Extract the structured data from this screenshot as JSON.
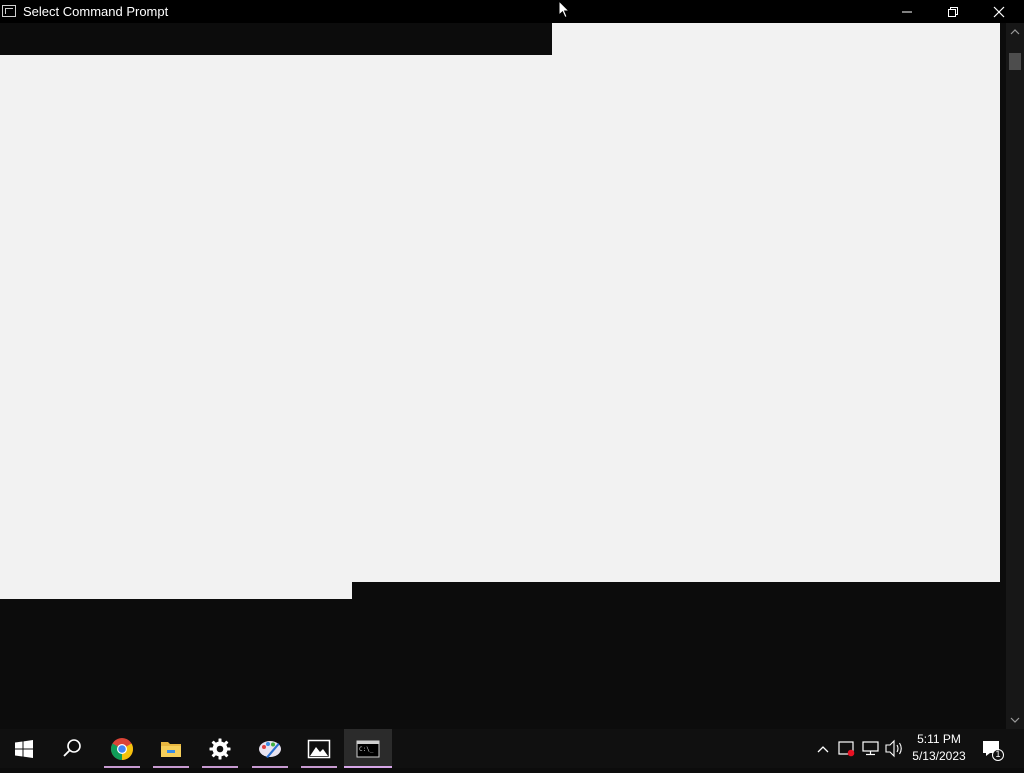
{
  "window": {
    "title": "Select Command Prompt",
    "controls": [
      "minimize",
      "restore",
      "close"
    ]
  },
  "console": {
    "selection_color": "#f2f2f2",
    "background_color": "#0c0c0c"
  },
  "taskbar": {
    "pinned": [
      {
        "name": "start-icon"
      },
      {
        "name": "search-icon"
      },
      {
        "name": "chrome-icon"
      },
      {
        "name": "file-explorer-icon"
      },
      {
        "name": "settings-icon"
      },
      {
        "name": "paint-icon"
      },
      {
        "name": "photos-icon"
      },
      {
        "name": "command-prompt-icon",
        "active": true
      }
    ],
    "accent": "#d7a6e8",
    "tray": {
      "time": "5:11 PM",
      "date": "5/13/2023",
      "notification_count": "1"
    }
  }
}
